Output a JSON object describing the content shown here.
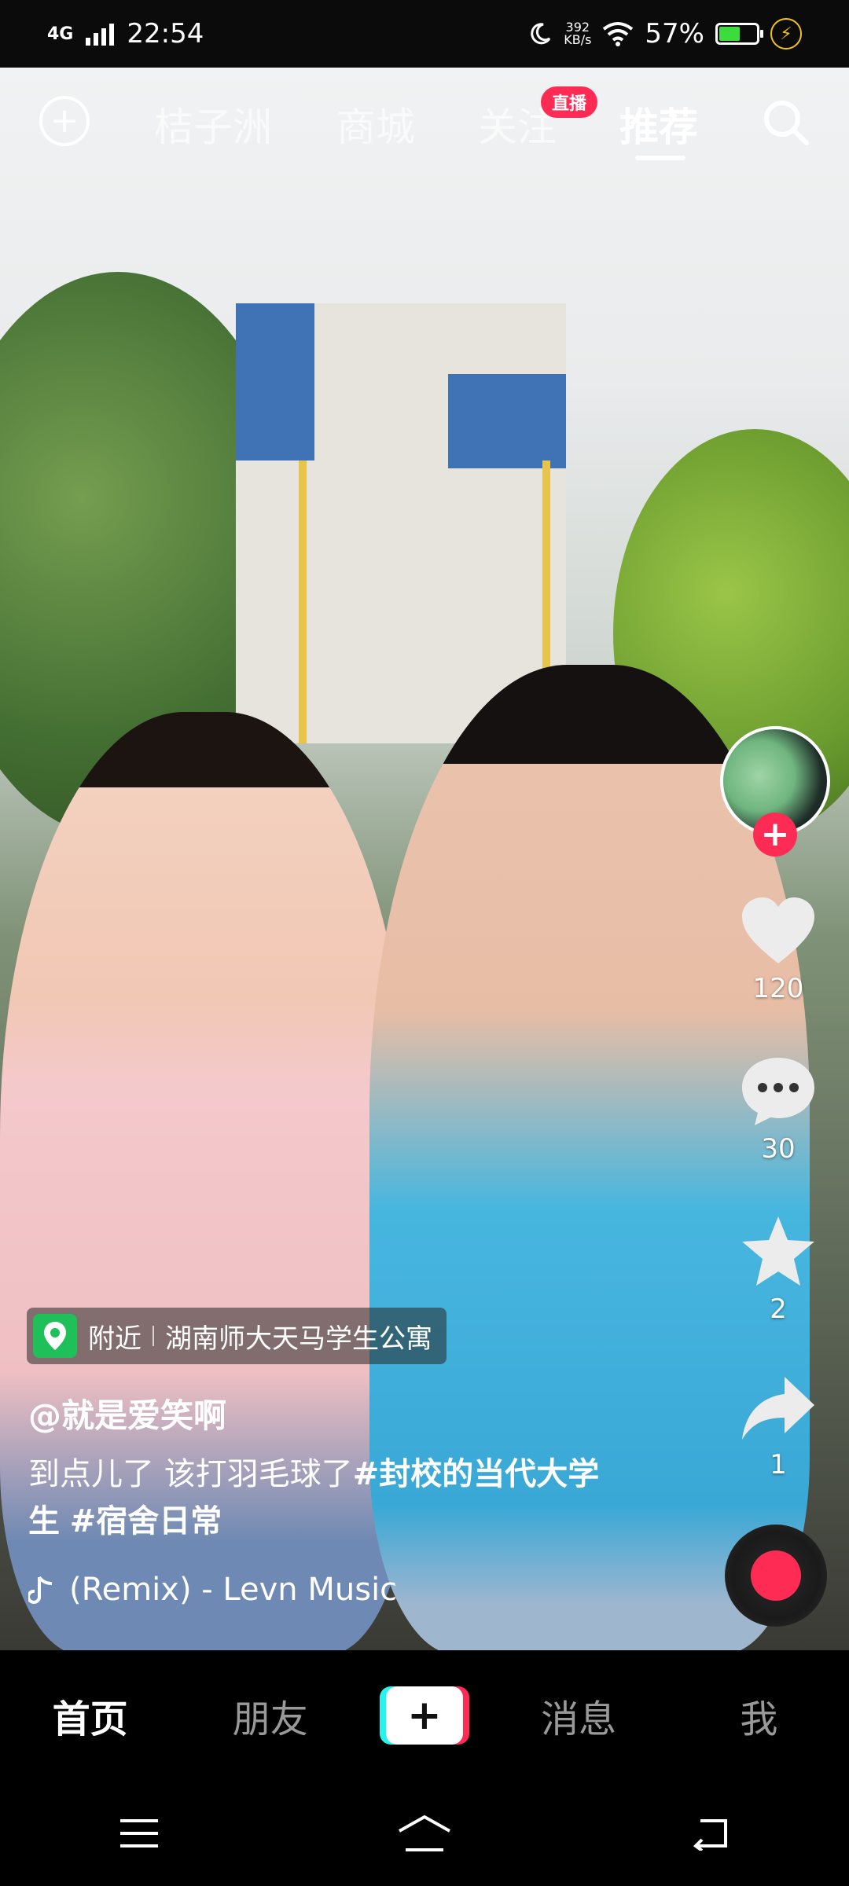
{
  "status_bar": {
    "network": "4G",
    "time": "22:54",
    "speed_value": "392",
    "speed_unit": "KB/s",
    "battery": "57%",
    "battery_level": 0.57
  },
  "top_nav": {
    "tabs": [
      {
        "label": "桔子洲"
      },
      {
        "label": "商城"
      },
      {
        "label": "关注"
      },
      {
        "label": "推荐"
      }
    ],
    "live_badge": "直播",
    "active_tab": "推荐"
  },
  "side_actions": {
    "like_count": "120",
    "comment_count": "30",
    "favorite_count": "2",
    "share_count": "1"
  },
  "post": {
    "location_type": "附近",
    "location_name": "湖南师大天马学生公寓",
    "author": "@就是爱笑啊",
    "caption": "到点儿了 该打羽毛球了",
    "tag1": "#封校的当代大学生",
    "tag2": "#宿舍日常",
    "music": "(Remix) - Levn Music"
  },
  "bottom_nav": {
    "home": "首页",
    "friends": "朋友",
    "messages": "消息",
    "me": "我"
  },
  "colors": {
    "accent": "#fe2c55",
    "cyan": "#25f4ee",
    "location_green": "#1fbf5a"
  }
}
